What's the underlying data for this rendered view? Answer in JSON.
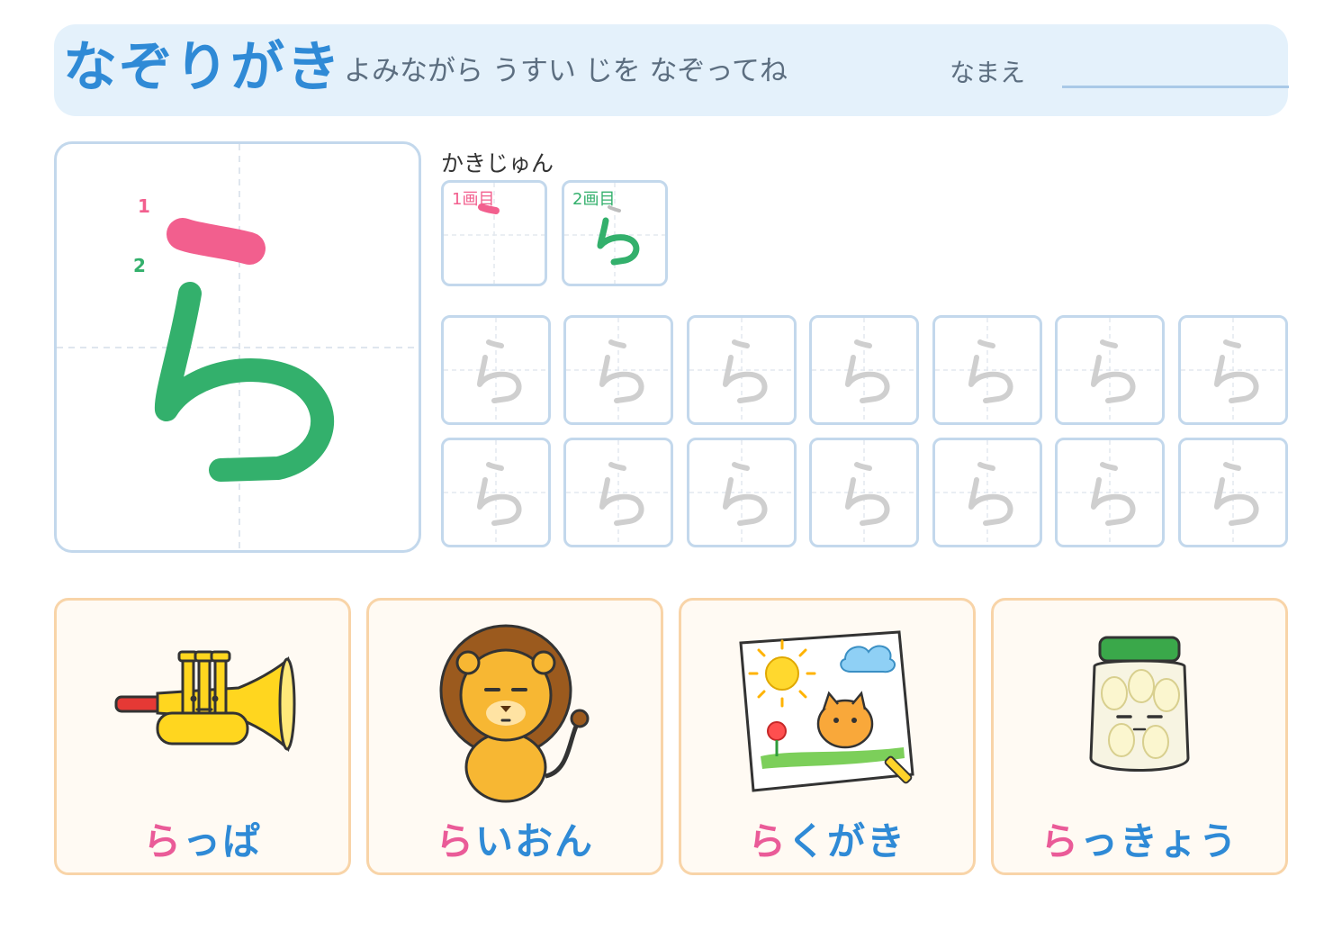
{
  "header": {
    "title": "なぞりがき",
    "subtitle": "よみながら うすい じを なぞってね",
    "name_label": "なまえ"
  },
  "model": {
    "character": "ら",
    "stroke_numbers": [
      "1",
      "2"
    ],
    "stroke_colors": [
      "#f25f8e",
      "#33b06c"
    ]
  },
  "stroke_order": {
    "label": "かきじゅん",
    "steps": [
      {
        "label": "1画目",
        "color": "#f25f8e"
      },
      {
        "label": "2画目",
        "color": "#33b06c"
      }
    ]
  },
  "practice": {
    "rows": 2,
    "columns": 7,
    "trace_character": "ら"
  },
  "words": [
    {
      "first": "ら",
      "rest": "っぱ",
      "picture": "trumpet-illustration"
    },
    {
      "first": "ら",
      "rest": "いおん",
      "picture": "lion-illustration"
    },
    {
      "first": "ら",
      "rest": "くがき",
      "picture": "scribble-drawing-illustration"
    },
    {
      "first": "ら",
      "rest": "っきょう",
      "picture": "pickled-shallot-jar-illustration"
    }
  ]
}
